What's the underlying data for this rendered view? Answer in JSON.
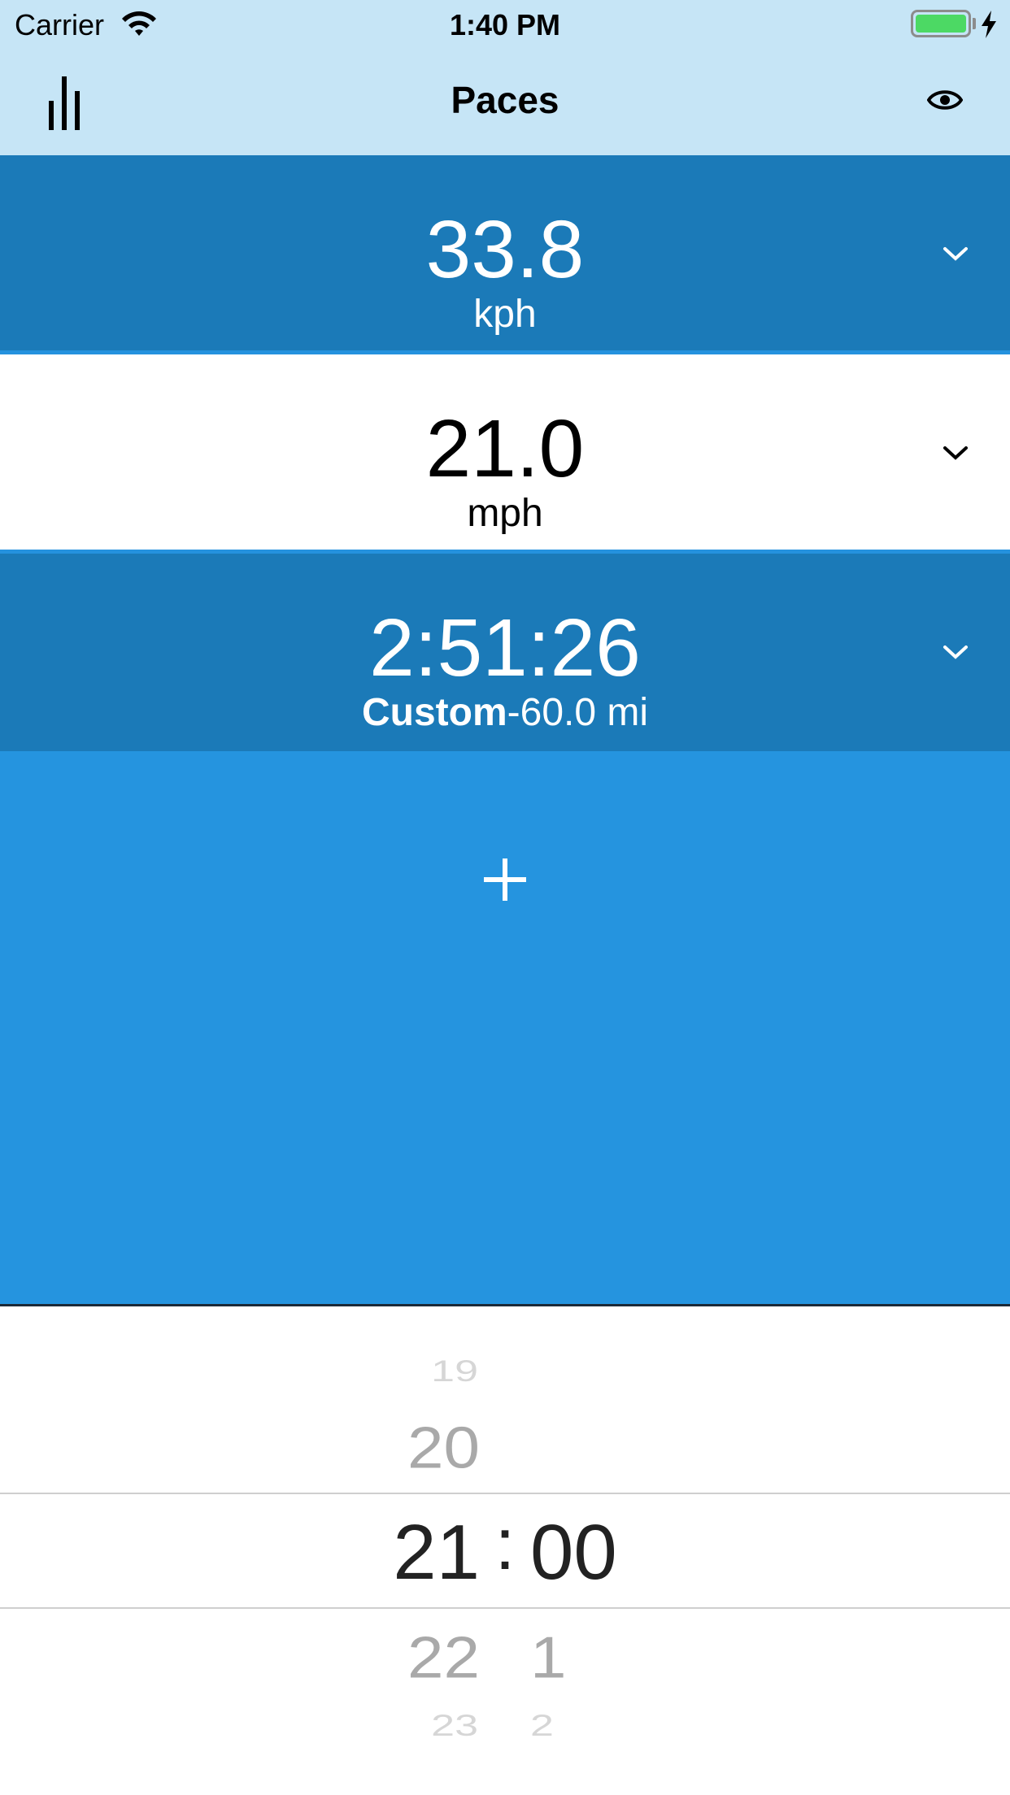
{
  "status_bar": {
    "carrier": "Carrier",
    "time": "1:40 PM",
    "battery_level": 1.0,
    "charging": true,
    "battery_color": "#4cd964"
  },
  "nav": {
    "title": "Paces",
    "left_icon": "bar-chart-icon",
    "right_icon": "eye-icon",
    "background": "#c6e5f6"
  },
  "paces": [
    {
      "value": "33.8",
      "unit": "kph",
      "highlighted": true
    },
    {
      "value": "21.0",
      "unit": "mph",
      "highlighted": false
    },
    {
      "value": "2:51:26",
      "unit_bold": "Custom",
      "unit": "-60.0 mi",
      "highlighted": true
    }
  ],
  "add_button": {
    "label": "+",
    "background": "#2594df"
  },
  "picker": {
    "hours": [
      "19",
      "20",
      "21",
      "22",
      "23"
    ],
    "minutes": [
      "00",
      "1",
      "2"
    ],
    "selected_hour": "21",
    "selected_minute": "00",
    "separator": ":"
  },
  "colors": {
    "row_dark": "#1b7ab8",
    "row_light": "#ffffff",
    "accent": "#2592de"
  }
}
